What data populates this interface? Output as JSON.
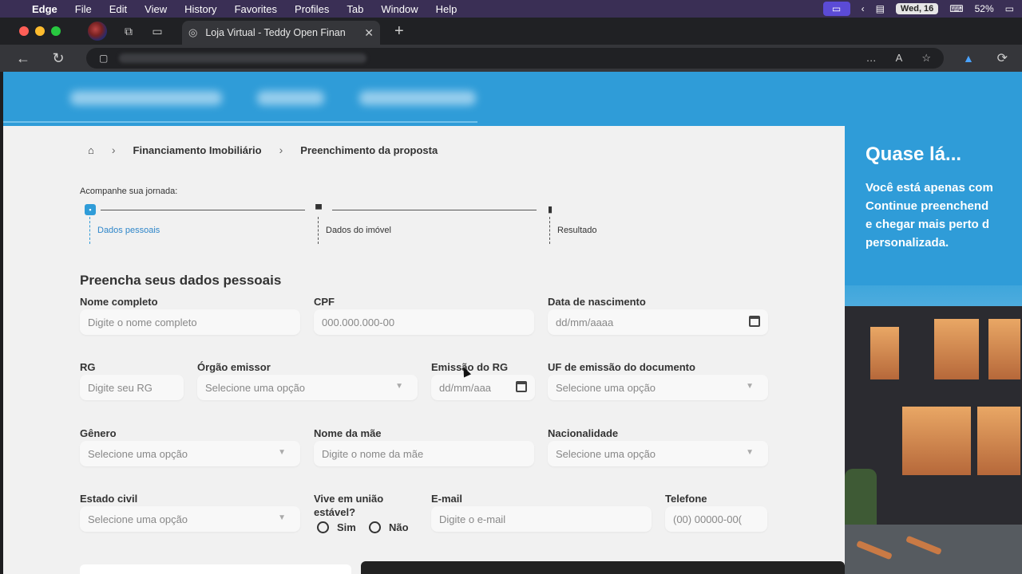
{
  "menubar": {
    "app": "Edge",
    "items": [
      "File",
      "Edit",
      "View",
      "History",
      "Favorites",
      "Profiles",
      "Tab",
      "Window",
      "Help"
    ],
    "date": "Wed, 16",
    "battery": "52%"
  },
  "browser": {
    "tab_title": "Loja Virtual - Teddy Open Finan",
    "address_actions": [
      "…",
      "A"
    ]
  },
  "breadcrumb": {
    "items": [
      "Financiamento Imobiliário",
      "Preenchimento da proposta"
    ]
  },
  "journey": {
    "label": "Acompanhe sua jornada:",
    "steps": [
      {
        "label": "Dados pessoais",
        "active": true,
        "icon": "id-card-icon"
      },
      {
        "label": "Dados do imóvel",
        "active": false,
        "icon": "car-icon"
      },
      {
        "label": "Resultado",
        "active": false,
        "icon": "database-icon"
      }
    ]
  },
  "form": {
    "title": "Preencha seus dados pessoais",
    "fields": {
      "nome": {
        "label": "Nome completo",
        "placeholder": "Digite o nome completo"
      },
      "cpf": {
        "label": "CPF",
        "placeholder": "000.000.000-00"
      },
      "nascimento": {
        "label": "Data de nascimento",
        "placeholder": "dd/mm/aaaa"
      },
      "rg": {
        "label": "RG",
        "placeholder": "Digite seu RG"
      },
      "orgao": {
        "label": "Órgão emissor",
        "placeholder": "Selecione uma opção"
      },
      "emissao_rg": {
        "label": "Emissão do RG",
        "placeholder": "dd/mm/aaa"
      },
      "uf": {
        "label": "UF de emissão do documento",
        "placeholder": "Selecione uma opção"
      },
      "genero": {
        "label": "Gênero",
        "placeholder": "Selecione uma opção"
      },
      "mae": {
        "label": "Nome da mãe",
        "placeholder": "Digite o nome da mãe"
      },
      "nacionalidade": {
        "label": "Nacionalidade",
        "placeholder": "Selecione uma opção"
      },
      "estado_civil": {
        "label": "Estado civil",
        "placeholder": "Selecione uma opção"
      },
      "uniao_estavel": {
        "label_line1": "Vive em união",
        "label_line2": "estável?",
        "option_yes": "Sim",
        "option_no": "Não"
      },
      "email": {
        "label": "E-mail",
        "placeholder": "Digite o e-mail"
      },
      "telefone": {
        "label": "Telefone",
        "placeholder": "(00) 00000-00("
      }
    }
  },
  "promo": {
    "title": "Quase lá...",
    "lines": [
      "Você está apenas com",
      "Continue preenchend",
      "e chegar mais perto d",
      "personalizada."
    ]
  },
  "colors": {
    "brand_blue": "#2f9cd8",
    "page_bg": "#f1f1f1"
  }
}
